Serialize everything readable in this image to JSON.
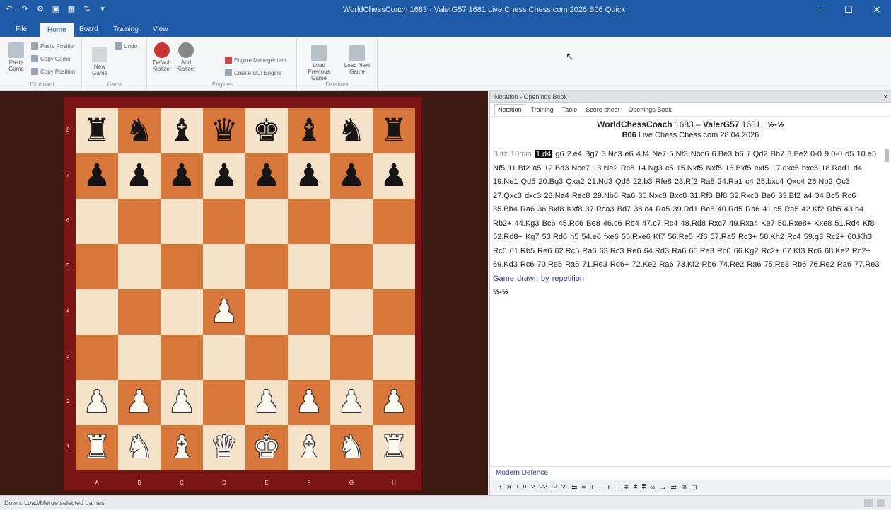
{
  "titlebar": {
    "title": "WorldChessCoach 1683 - ValerG57 1681 Live Chess Chess.com 2026 B06 Quick"
  },
  "ribbon": {
    "tabs": [
      "File",
      "Home",
      "Board",
      "Training",
      "View"
    ],
    "active_tab": "Home",
    "clipboard": {
      "paste_game": "Paste Game",
      "paste_position": "Paste Position",
      "copy_game": "Copy Game",
      "copy_position": "Copy Position",
      "label": "Clipboard"
    },
    "game": {
      "undo": "Undo",
      "new_game": "New Game",
      "label": "Game"
    },
    "engines": {
      "default_kibitzer": "Default Kibitzer",
      "add_kibitzer": "Add Kibitzer",
      "engine_management": "Engine Management",
      "create_uci_engine": "Create UCI Engine",
      "label": "Engines"
    },
    "database": {
      "load_previous": "Load Previous Game",
      "load_next": "Load Next Game",
      "label": "Database"
    }
  },
  "board": {
    "rows": [
      [
        "bR",
        "bN",
        "bB",
        "bQ",
        "bK",
        "bB",
        "bN",
        "bR"
      ],
      [
        "bP",
        "bP",
        "bP",
        "bP",
        "bP",
        "bP",
        "bP",
        "bP"
      ],
      [
        "",
        "",
        "",
        "",
        "",
        "",
        "",
        ""
      ],
      [
        "",
        "",
        "",
        "",
        "",
        "",
        "",
        ""
      ],
      [
        "",
        "",
        "",
        "wP",
        "",
        "",
        "",
        ""
      ],
      [
        "",
        "",
        "",
        "",
        "",
        "",
        "",
        ""
      ],
      [
        "wP",
        "wP",
        "wP",
        "",
        "wP",
        "wP",
        "wP",
        "wP"
      ],
      [
        "wR",
        "wN",
        "wB",
        "wQ",
        "wK",
        "wB",
        "wN",
        "wR"
      ]
    ],
    "ranks": [
      "8",
      "7",
      "6",
      "5",
      "4",
      "3",
      "2",
      "1"
    ],
    "files": [
      "A",
      "B",
      "C",
      "D",
      "E",
      "F",
      "G",
      "H"
    ]
  },
  "panel": {
    "title": "Notation - Openings Book",
    "subtabs": [
      "Notation",
      "Training",
      "Table",
      "Score sheet",
      "Openings Book"
    ],
    "active_subtab": "Notation",
    "white_name": "WorldChessCoach",
    "white_elo": "1683",
    "black_name": "ValerG57",
    "black_elo": "1681",
    "result": "½-½",
    "eco": "B06",
    "event": "Live Chess Chess.com 28.04.2026",
    "intro": "Blitz 10min",
    "current_move": "1.d4",
    "moves_text": "g6 2.e4 Bg7 3.Nc3 e6 4.f4 Ne7 5.Nf3 Nbc6 6.Be3 b6 7.Qd2 Bb7 8.Be2 0-0 9.0-0 d5 10.e5 Nf5 11.Bf2 a5 12.Bd3 Nce7 13.Ne2 Rc8 14.Ng3 c5 15.Nxf5 Nxf5 16.Bxf5 exf5 17.dxc5 bxc5 18.Rad1 d4 19.Ne1 Qd5 20.Bg3 Qxa2 21.Nd3 Qd5 22.b3 Rfe8 23.Rf2 Ra8 24.Ra1 c4 25.bxc4 Qxc4 26.Nb2 Qc3 27.Qxc3 dxc3 28.Na4 Rec8 29.Nb6 Ra6 30.Nxc8 Bxc8 31.Rf3 Bf8 32.Rxc3 Be6 33.Bf2 a4 34.Bc5 Rc6 35.Bb4 Ra6 36.Bxf8 Kxf8 37.Rca3 Bd7 38.c4 Ra5 39.Rd1 Be8 40.Rd5 Ra6 41.c5 Ra5 42.Kf2 Rb5 43.h4 Rb2+ 44.Kg3 Bc6 45.Rd6 Be8 46.c6 Rb4 47.c7 Rc4 48.Rd8 Rxc7 49.Rxa4 Ke7 50.Rxe8+ Kxe8 51.Rd4 Kf8 52.Rd8+ Kg7 53.Rd6 h5 54.e6 fxe6 55.Rxe6 Kf7 56.Re5 Kf6 57.Ra5 Rc3+ 58.Kh2 Rc4 59.g3 Rc2+ 60.Kh3 Rc6 61.Rb5 Re6 62.Rc5 Ra6 63.Rc3 Re6 64.Rd3 Ra6 65.Re3 Rc6 66.Kg2 Rc2+ 67.Kf3 Rc6 68.Ke2 Rc2+ 69.Kd3 Rc6 70.Re5 Ra6 71.Re3 Rd6+ 72.Ke2 Ra6 73.Kf2 Rb6 74.Re2 Ra6 75.Re3 Rb6 76.Re2 Ra6 77.Re3",
    "comment": "Game drawn by repetition",
    "final_result": "½-½",
    "opening_name": "Modern Defence",
    "annotation_symbols": [
      "↑",
      "✕",
      "!",
      "!!",
      "?",
      "??",
      "!?",
      "?!",
      "⇆",
      "=",
      "+−",
      "−+",
      "±",
      "∓",
      "⩲",
      "⩱",
      "∞",
      "→",
      "⇄",
      "⊕",
      "⊡"
    ]
  },
  "statusbar": {
    "text": "Down: Load/Merge selected games"
  }
}
